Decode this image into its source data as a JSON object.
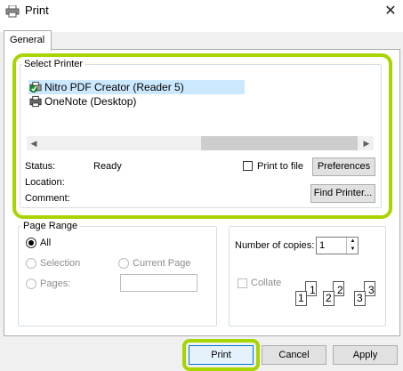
{
  "window": {
    "title": "Print",
    "close_glyph": "✕"
  },
  "tabs": [
    {
      "label": "General"
    }
  ],
  "select_printer": {
    "legend": "Select Printer",
    "printers": [
      {
        "name": "Nitro PDF Creator (Reader 5)",
        "selected": true,
        "icon": "printer-default-icon"
      },
      {
        "name": "OneNote (Desktop)",
        "selected": false,
        "icon": "printer-icon"
      }
    ],
    "status_label": "Status:",
    "status_value": "Ready",
    "location_label": "Location:",
    "comment_label": "Comment:",
    "print_to_file_label": "Print to file",
    "preferences_label": "Preferences",
    "find_printer_label": "Find Printer..."
  },
  "page_range": {
    "legend": "Page Range",
    "all_label": "All",
    "selection_label": "Selection",
    "current_page_label": "Current Page",
    "pages_label": "Pages:"
  },
  "copies": {
    "label": "Number of copies:",
    "value": "1",
    "collate_label": "Collate",
    "collate_pages": [
      "1",
      "1",
      "2",
      "2",
      "3",
      "3"
    ]
  },
  "buttons": {
    "print": "Print",
    "cancel": "Cancel",
    "apply": "Apply"
  },
  "colors": {
    "highlight": "#a8d400",
    "selection": "#cce8ff"
  }
}
